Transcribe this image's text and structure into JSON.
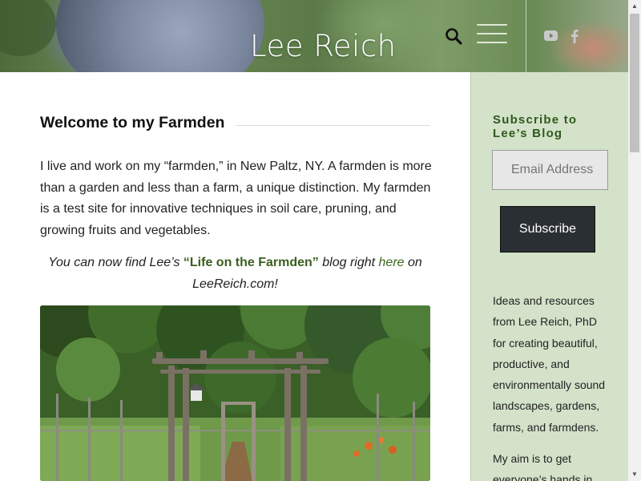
{
  "header": {
    "site_title": "Lee Reich",
    "icons": {
      "search": "search-icon",
      "menu": "hamburger-menu-icon",
      "youtube": "youtube-icon",
      "facebook": "facebook-icon"
    }
  },
  "main": {
    "title": "Welcome to my Farmden",
    "intro": "I live and work on my “farmden,” in New Paltz, NY. A farmden is more than a garden and less than a farm, a unique distinction. My farmden is a test site for innovative techniques in soil care, pruning, and growing fruits and vegetables.",
    "blog_note": {
      "prefix": "You can now find Lee’s ",
      "blog_name": "“Life on the Farmden”",
      "middle": " blog right ",
      "link_text": "here",
      "suffix": " on LeeReich.com!"
    }
  },
  "sidebar": {
    "subscribe_title": "Subscribe to Lee’s Blog",
    "email_placeholder": "Email Address",
    "subscribe_button": "Subscribe",
    "description": "Ideas and resources from Lee Reich, PhD for creating beautiful, productive, and environmentally sound landscapes, gardens, farms, and farmdens.",
    "aim": "My aim is to get everyone’s hands in"
  },
  "colors": {
    "sidebar_bg": "#d3e2c9",
    "sidebar_title": "#2f5a1c",
    "accent_link": "#3b6b20",
    "button_bg": "#2a2f33"
  }
}
